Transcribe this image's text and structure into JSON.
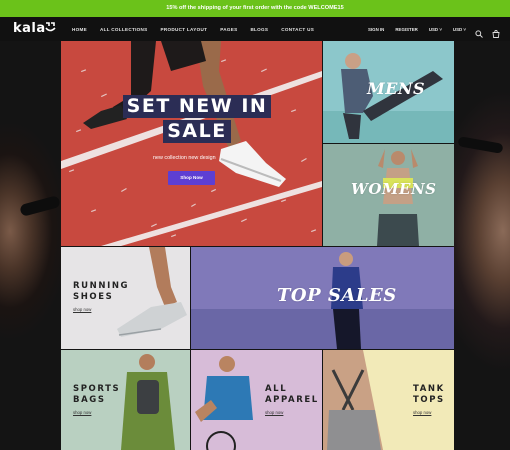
{
  "announcement": "15% off the shipping of your first order with the code WELCOME15",
  "header": {
    "logo": "kala",
    "nav": [
      "HOME",
      "ALL COLLECTIONS",
      "PRODUCT LAYOUT",
      "PAGES",
      "BLOGS",
      "CONTACT US"
    ],
    "sign_in": "SIGN IN",
    "register": "REGISTER",
    "currency": "USD",
    "secondary": "USD"
  },
  "hero": {
    "title_line1": "SET NEW IN",
    "title_line2": "SALE",
    "subtitle": "new collection  new design",
    "button": "Shop Now"
  },
  "tiles": {
    "mens": "MENS",
    "womens": "WOMENS",
    "running": {
      "line1": "RUNNING",
      "line2": "SHOES",
      "link": "shop now"
    },
    "top_sales": "TOP SALES",
    "bags": {
      "line1": "SPORTS",
      "line2": "BAGS",
      "link": "shop now"
    },
    "apparel": {
      "line1": "ALL",
      "line2": "APPAREL",
      "link": "shop now"
    },
    "tank": {
      "line1": "TANK",
      "line2": "TOPS",
      "link": "shop now"
    }
  },
  "colors": {
    "announcement_bg": "#6bc21a",
    "hero_bg": "#c6473f",
    "button": "#5d3fd3",
    "title_bg": "#2b2d55"
  },
  "icons": [
    "search-icon",
    "cart-icon",
    "chevron-down-icon"
  ]
}
